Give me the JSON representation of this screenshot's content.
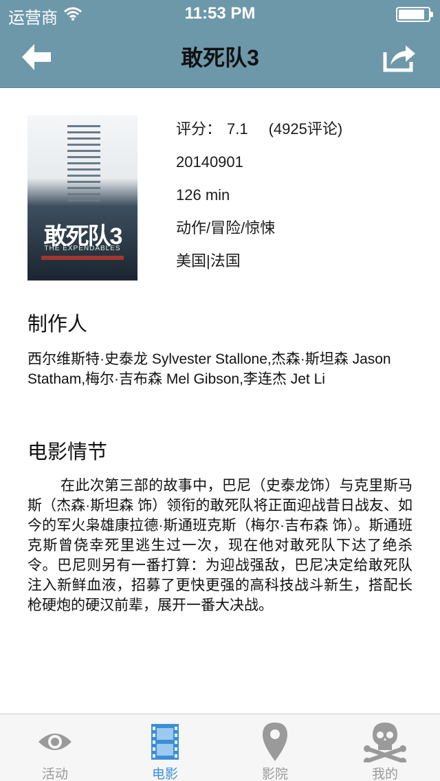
{
  "status_bar": {
    "carrier": "运营商",
    "time": "11:53 PM",
    "battery_level": 0.9
  },
  "nav": {
    "title": "敢死队3",
    "back_icon": "back-arrow-icon",
    "share_icon": "share-icon"
  },
  "movie": {
    "poster": {
      "title_text": "敢死队3",
      "subtitle_text": "THE EXPENDABLES"
    },
    "rating_label": "评分：",
    "rating_value": "7.1",
    "rating_count": "(4925评论)",
    "release_date": "20140901",
    "duration": "126 min",
    "genres": "动作/冒险/惊悚",
    "countries": "美国|法国"
  },
  "producers": {
    "heading": "制作人",
    "text": "西尔维斯特·史泰龙 Sylvester Stallone,杰森·斯坦森 Jason Statham,梅尔·吉布森 Mel Gibson,李连杰 Jet Li"
  },
  "plot": {
    "heading": "电影情节",
    "text": "在此次第三部的故事中，巴尼（史泰龙饰）与克里斯马斯（杰森·斯坦森 饰）领衔的敢死队将正面迎战昔日战友、如今的军火枭雄康拉德·斯通班克斯（梅尔·吉布森 饰）。斯通班克斯曾侥幸死里逃生过一次，现在他对敢死队下达了绝杀令。巴尼则另有一番打算：为迎战强敌，巴尼决定给敢死队注入新鲜血液，招募了更快更强的高科技战斗新生，搭配长枪硬炮的硬汉前辈，展开一番大决战。"
  },
  "tabbar": {
    "tabs": [
      {
        "label": "活动",
        "icon": "eye-icon",
        "active": false
      },
      {
        "label": "电影",
        "icon": "film-icon",
        "active": true
      },
      {
        "label": "影院",
        "icon": "location-pin-icon",
        "active": false
      },
      {
        "label": "我的",
        "icon": "skull-crossbones-icon",
        "active": false
      }
    ]
  },
  "colors": {
    "header_bg": "#6d98aa",
    "tab_active": "#3b8fd6",
    "tab_inactive": "#9a9a9a"
  }
}
